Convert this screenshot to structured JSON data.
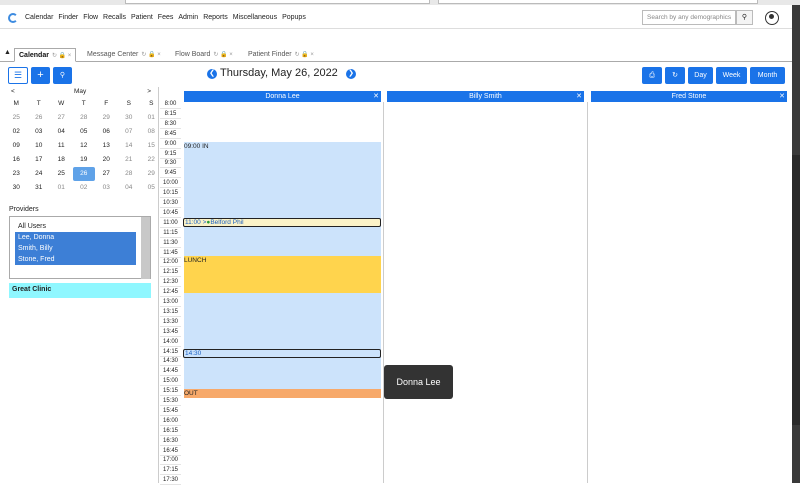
{
  "menu": {
    "items": [
      "Calendar",
      "Finder",
      "Flow",
      "Recalls",
      "Patient",
      "Fees",
      "Admin",
      "Reports",
      "Miscellaneous",
      "Popups"
    ]
  },
  "search": {
    "placeholder": "Search by any demographics",
    "btn_icon": "search-icon"
  },
  "tabs": [
    {
      "label": "Calendar",
      "active": true
    },
    {
      "label": "Message Center",
      "active": false
    },
    {
      "label": "Flow Board",
      "active": false
    },
    {
      "label": "Patient Finder",
      "active": false
    }
  ],
  "toolbar": {
    "date_title": "Thursday, May 26, 2022",
    "day": "Day",
    "week": "Week",
    "month": "Month"
  },
  "mini_calendar": {
    "month": "May",
    "prev": "<",
    "next": ">",
    "dow": [
      "M",
      "T",
      "W",
      "T",
      "F",
      "S",
      "S"
    ],
    "weeks": [
      [
        "25",
        "26",
        "27",
        "28",
        "29",
        "30",
        "01"
      ],
      [
        "02",
        "03",
        "04",
        "05",
        "06",
        "07",
        "08"
      ],
      [
        "09",
        "10",
        "11",
        "12",
        "13",
        "14",
        "15"
      ],
      [
        "16",
        "17",
        "18",
        "19",
        "20",
        "21",
        "22"
      ],
      [
        "23",
        "24",
        "25",
        "26",
        "27",
        "28",
        "29"
      ],
      [
        "30",
        "31",
        "01",
        "02",
        "03",
        "04",
        "05"
      ]
    ],
    "selected": "26"
  },
  "providers": {
    "label": "Providers",
    "items": [
      {
        "name": "All Users",
        "selected": false
      },
      {
        "name": "Lee, Donna",
        "selected": true
      },
      {
        "name": "Smith, Billy",
        "selected": true
      },
      {
        "name": "Stone, Fred",
        "selected": true
      }
    ]
  },
  "facility": "Great Clinic",
  "times": [
    "8:00",
    "8:15",
    "8:30",
    "8:45",
    "9:00",
    "9:15",
    "9:30",
    "9:45",
    "10:00",
    "10:15",
    "10:30",
    "10:45",
    "11:00",
    "11:15",
    "11:30",
    "11:45",
    "12:00",
    "12:15",
    "12:30",
    "12:45",
    "13:00",
    "13:15",
    "13:30",
    "13:45",
    "14:00",
    "14:15",
    "14:30",
    "14:45",
    "15:00",
    "15:15",
    "15:30",
    "15:45",
    "16:00",
    "16:15",
    "16:30",
    "16:45",
    "17:00",
    "17:15",
    "17:30"
  ],
  "columns": [
    {
      "name": "Donna Lee",
      "close": "✕"
    },
    {
      "name": "Billy Smith",
      "close": "✕"
    },
    {
      "name": "Fred Stone",
      "close": "✕"
    }
  ],
  "events": {
    "in_label": "09:00 IN",
    "appt1": "11:00 >",
    "appt1_patient": "Belford Phil",
    "lunch": "LUNCH",
    "appt2": "14:30",
    "out": "OUT"
  },
  "tooltip": "Donna Lee",
  "colors": {
    "accent": "#1a73e8",
    "available": "#cce3fb",
    "lunch": "#ffd44d",
    "out": "#f7a96a",
    "facility": "#8ff7ff"
  }
}
